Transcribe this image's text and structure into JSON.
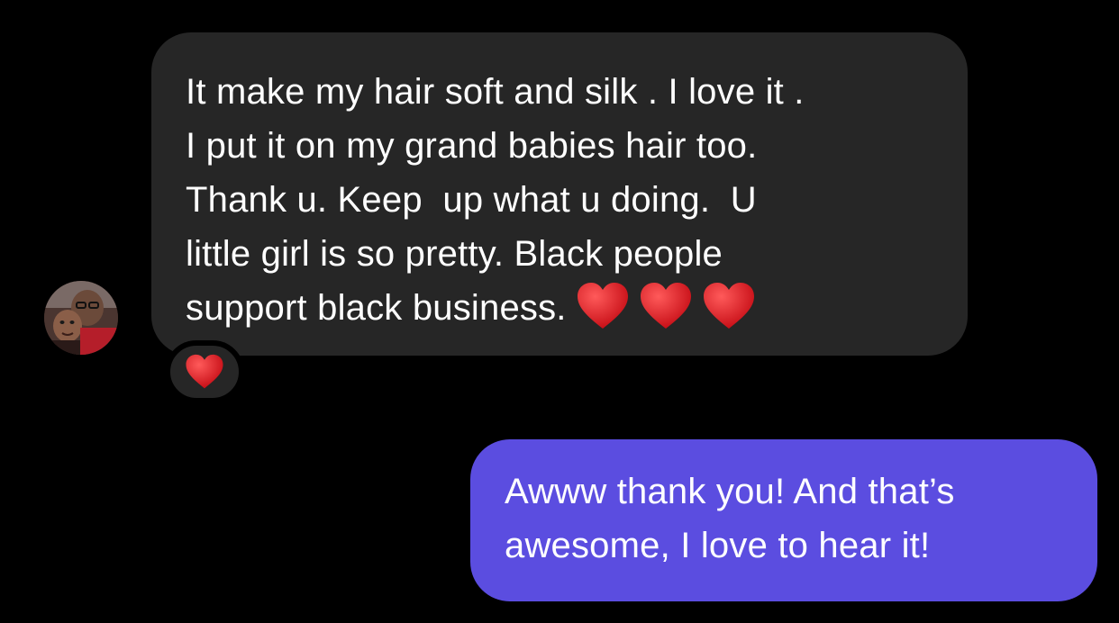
{
  "thread": {
    "incoming": {
      "lines": [
        "It make my hair soft and silk . I love it .",
        "I put it on my grand babies hair too.",
        "Thank u. Keep  up what u doing.  U",
        "little girl is so pretty. Black people",
        "support black business."
      ],
      "trailing_emoji": [
        "red-heart-emoji",
        "red-heart-emoji",
        "red-heart-emoji"
      ],
      "reaction": "red-heart-emoji"
    },
    "outgoing": {
      "lines": [
        "Awww thank you! And that’s",
        "awesome, I love to hear it!"
      ]
    }
  },
  "colors": {
    "background": "#000000",
    "incoming_bubble": "#262626",
    "outgoing_bubble": "#5b4de0",
    "text": "#ffffff",
    "heart": "#e0282e"
  }
}
